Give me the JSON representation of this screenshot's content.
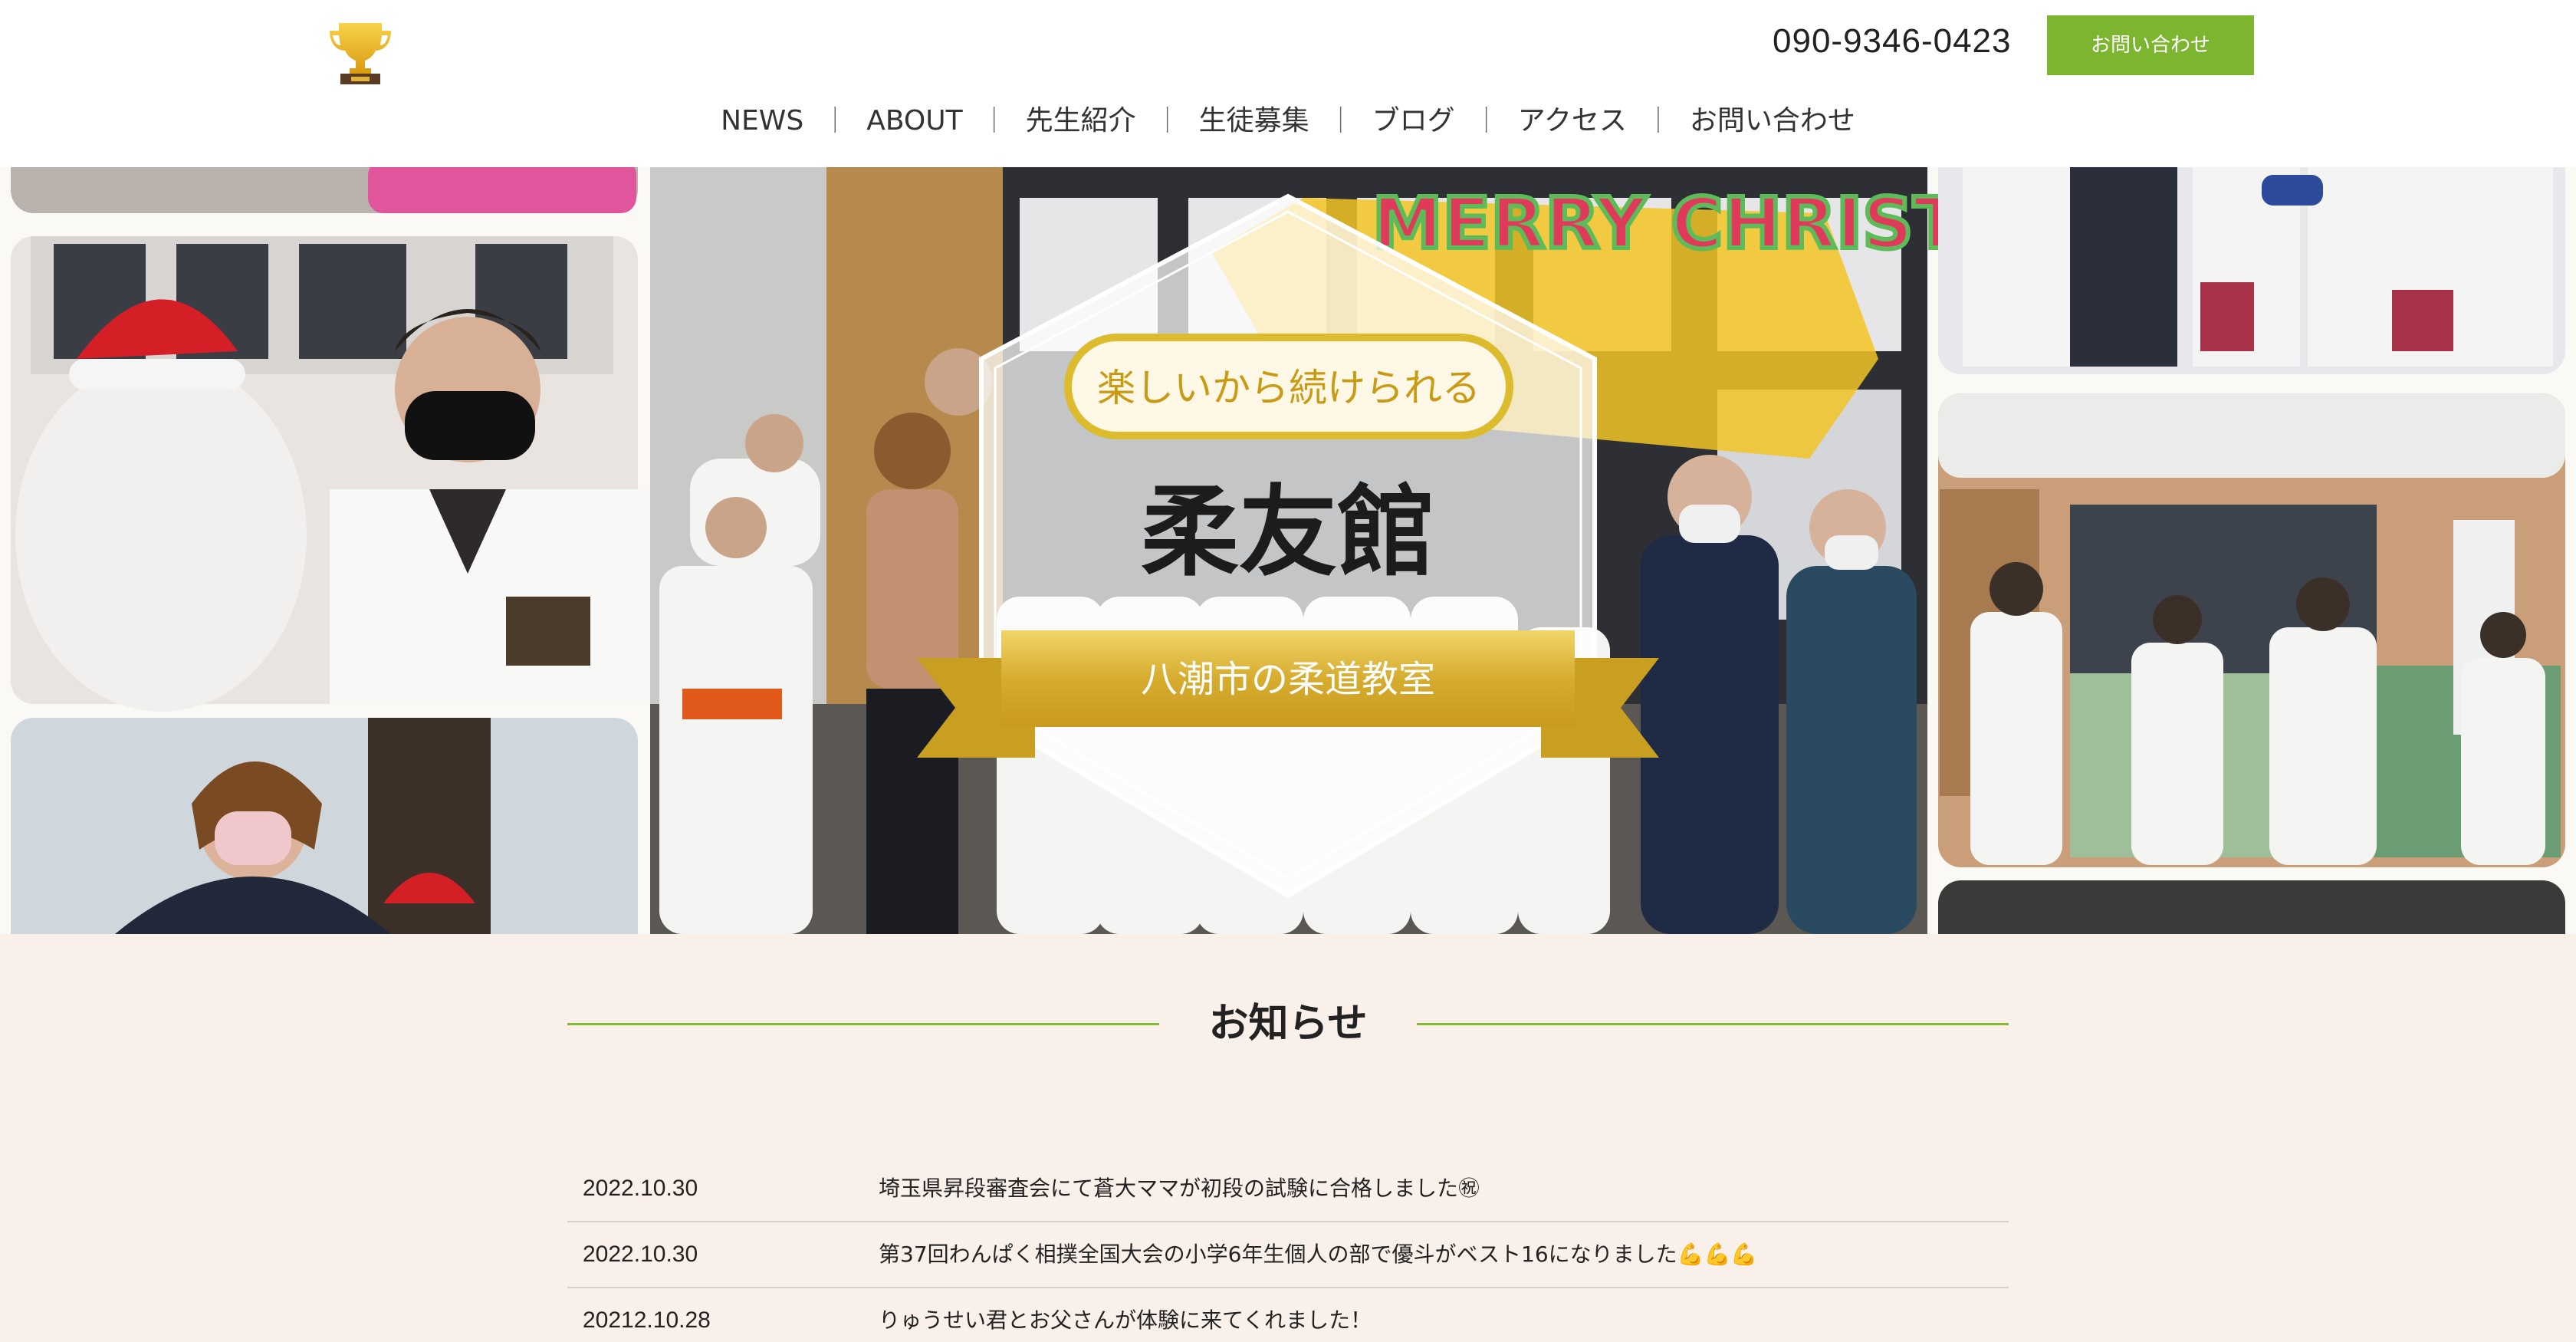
{
  "header": {
    "phone": "090-9346-0423",
    "contact_button": "お問い合わせ",
    "logo_icon": "trophy-icon"
  },
  "nav": {
    "items": [
      "NEWS",
      "ABOUT",
      "先生紹介",
      "生徒募集",
      "ブログ",
      "アクセス",
      "お問い合わせ"
    ],
    "separator": "｜"
  },
  "hero": {
    "tagline": "楽しいから続けられる",
    "title": "柔友館",
    "ribbon": "八潮市の柔道教室",
    "photo_sign": "MERRY CHRISTMAS"
  },
  "news": {
    "heading": "お知らせ",
    "items": [
      {
        "date": "2022.10.30",
        "text": "埼玉県昇段審査会にて蒼大ママが初段の試験に合格しました㊗"
      },
      {
        "date": "2022.10.30",
        "text": "第37回わんぱく相撲全国大会の小学6年生個人の部で優斗がベスト16になりました💪💪💪"
      },
      {
        "date": "20212.10.28",
        "text": "りゅうせい君とお父さんが体験に来てくれました！"
      }
    ]
  },
  "colors": {
    "accent_green": "#7cb52f",
    "gold": "#d8b434",
    "news_background": "#faf0ea"
  }
}
